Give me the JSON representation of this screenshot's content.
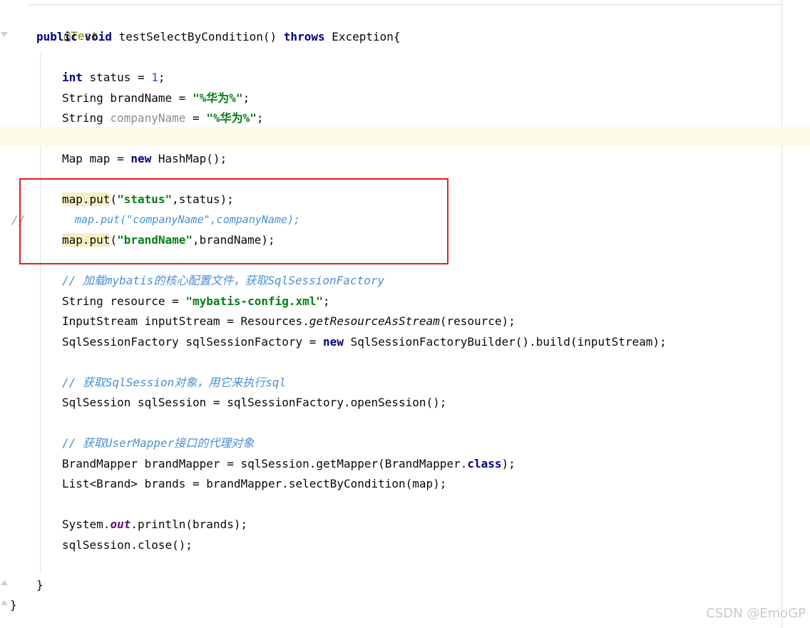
{
  "editor": {
    "lines": {
      "l1": {
        "annotation": "@Test"
      },
      "l2": {
        "t1": "public",
        "t2": " ",
        "t3": "void",
        "t4": " testSelectByCondition() ",
        "t5": "throws",
        "t6": " Exception{"
      },
      "l4": {
        "t1": "int",
        "t2": " status = ",
        "t3": "1",
        "t4": ";"
      },
      "l5": {
        "t1": "String brandName = ",
        "t2": "\"%华为%\"",
        "t3": ";"
      },
      "l6": {
        "t1": "String ",
        "t2": "companyName",
        "t3": " = ",
        "t4": "\"%华为%\"",
        "t5": ";"
      },
      "l8": {
        "t1": "Map map = ",
        "t2": "new",
        "t3": " HashMap();"
      },
      "l10": {
        "t1": "map.put",
        "t2": "(",
        "t3": "\"status\"",
        "t4": ",status);"
      },
      "l11": {
        "gutter": "//",
        "t1": "map.put(\"companyName\",companyName);"
      },
      "l12": {
        "t1": "map.put",
        "t2": "(",
        "t3": "\"brandName\"",
        "t4": ",brandName);"
      },
      "l14": {
        "t1": "// 加载mybatis的核心配置文件，获取SqlSessionFactory"
      },
      "l15": {
        "t1": "String resource = ",
        "t2": "\"mybatis-config.xml\"",
        "t3": ";"
      },
      "l16": {
        "t1": "InputStream inputStream = Resources.",
        "t2": "getResourceAsStream",
        "t3": "(resource);"
      },
      "l17": {
        "t1": "SqlSessionFactory sqlSessionFactory = ",
        "t2": "new",
        "t3": " SqlSessionFactoryBuilder().build(inputStream);"
      },
      "l19": {
        "t1": "// 获取SqlSession对象，用它来执行sql"
      },
      "l20": {
        "t1": "SqlSession sqlSession = sqlSessionFactory.openSession();"
      },
      "l22": {
        "t1": "// 获取UserMapper接口的代理对象"
      },
      "l23": {
        "t1": "BrandMapper brandMapper = sqlSession.getMapper(BrandMapper.",
        "t2": "class",
        "t3": ");"
      },
      "l24": {
        "t1": "List<Brand> brands = brandMapper.selectByCondition(map);"
      },
      "l26": {
        "t1": "System.",
        "t2": "out",
        "t3": ".println(brands);"
      },
      "l27": {
        "t1": "sqlSession.close();"
      },
      "l29": {
        "t1": "}"
      },
      "l30": {
        "t1": "}"
      }
    },
    "colors": {
      "keyword": "#000080",
      "string": "#067d17",
      "number": "#1750eb",
      "comment": "#4b8fd6",
      "annotation": "#808000",
      "highlight_box": "#e02020"
    }
  },
  "watermark": "CSDN @EmoGP"
}
